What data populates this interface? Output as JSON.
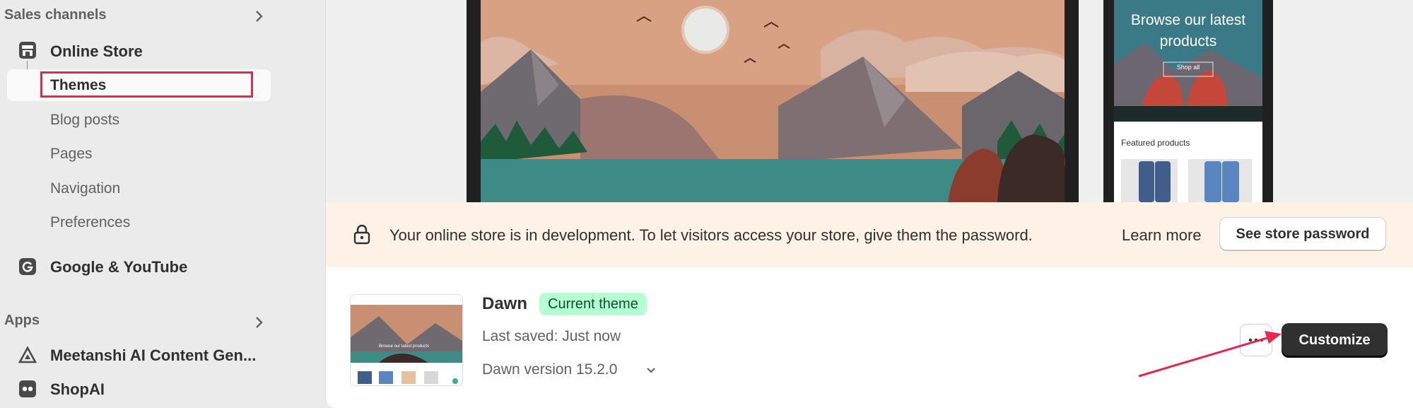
{
  "sidebar": {
    "sales_channels": "Sales channels",
    "online_store": "Online Store",
    "sub_items": [
      "Themes",
      "Blog posts",
      "Pages",
      "Navigation",
      "Preferences"
    ],
    "google": "Google & YouTube",
    "apps": "Apps",
    "app_items": [
      "Meetanshi AI Content Gen...",
      "ShopAI"
    ]
  },
  "preview": {
    "mobile_heading": "Browse our latest products",
    "mobile_button": "Shop all",
    "featured": "Featured products"
  },
  "banner": {
    "message": "Your online store is in development. To let visitors access your store, give them the password.",
    "learn_more": "Learn more",
    "password_button": "See store password"
  },
  "theme": {
    "name": "Dawn",
    "badge": "Current theme",
    "last_saved": "Last saved: Just now",
    "version": "Dawn version 15.2.0",
    "thumb_text": "Browse our latest products",
    "customize": "Customize"
  },
  "colors": {
    "highlight": "#e8264d",
    "badge_bg": "#b4fed2",
    "banner_bg": "#fdf2e5",
    "primary_button": "#303030"
  }
}
